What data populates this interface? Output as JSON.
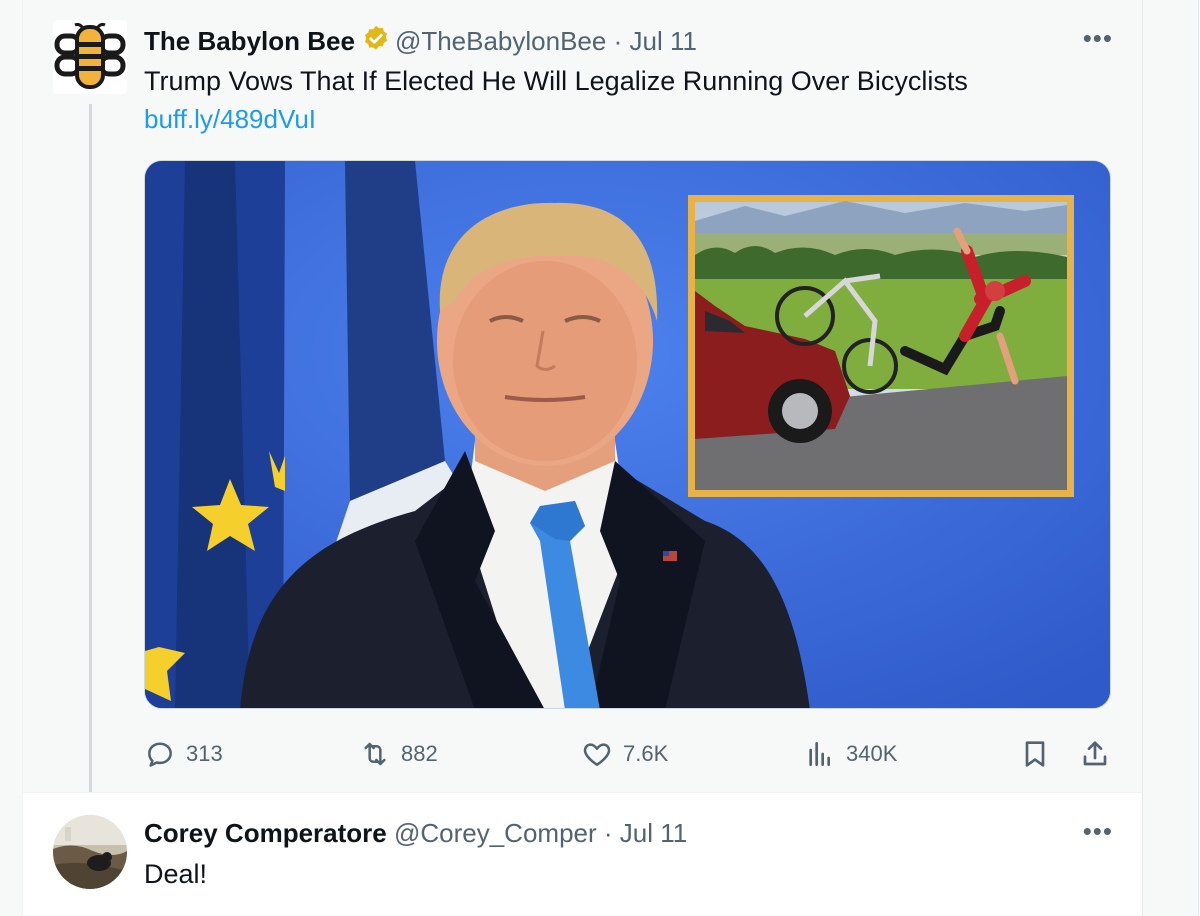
{
  "main_tweet": {
    "author_name": "The Babylon Bee",
    "handle": "@TheBabylonBee",
    "separator": "·",
    "date": "Jul 11",
    "text": "Trump Vows That If Elected He Will Legalize Running Over Bicyclists",
    "link": "buff.ly/489dVuI",
    "more_label": "•••",
    "stats": {
      "replies": "313",
      "retweets": "882",
      "likes": "7.6K",
      "views": "340K"
    },
    "icons": {
      "verified": "gold-verified-badge-icon",
      "reply": "speech-bubble-icon",
      "retweet": "retweet-arrows-icon",
      "like": "heart-icon",
      "views": "bar-chart-icon",
      "bookmark": "bookmark-icon",
      "share": "share-upload-icon"
    }
  },
  "reply_tweet": {
    "author_name": "Corey Comperatore",
    "handle": "@Corey_Comper",
    "separator": "·",
    "date": "Jul 11",
    "text": "Deal!",
    "more_label": "•••"
  },
  "colors": {
    "accent_link": "#1d9bf0",
    "secondary_text": "#536471",
    "verified_gold": "#e2b719",
    "thread_line": "#cfd9de",
    "media_background_blue": "#3566d4",
    "inset_frame_gold": "#e7b24a"
  }
}
